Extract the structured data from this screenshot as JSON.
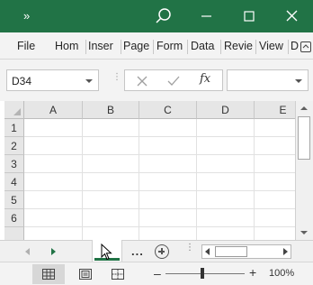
{
  "titlebar": {
    "quick_access": "»",
    "accent": "#217346",
    "icons": [
      "search-icon",
      "minimize-icon",
      "maximize-icon",
      "close-icon"
    ]
  },
  "ribbon": {
    "tabs": [
      "File",
      "Hom",
      "Inser",
      "Page",
      "Form",
      "Data",
      "Revie",
      "View",
      "D"
    ]
  },
  "formula_bar": {
    "name_box": "D34",
    "fx_label": "fx",
    "cancel_icon": "cancel-icon",
    "enter_icon": "check-icon",
    "formula_value": ""
  },
  "grid": {
    "columns": [
      "A",
      "B",
      "C",
      "D",
      "E"
    ],
    "rows": [
      "1",
      "2",
      "3",
      "4",
      "5",
      "6"
    ]
  },
  "sheet_tabs": {
    "more_label": "...",
    "active_tab_color": "#217346"
  },
  "statusbar": {
    "zoom_minus": "–",
    "zoom_plus": "+",
    "zoom_level": "100%",
    "views": [
      "normal-view-icon",
      "page-layout-icon",
      "page-break-icon"
    ]
  }
}
